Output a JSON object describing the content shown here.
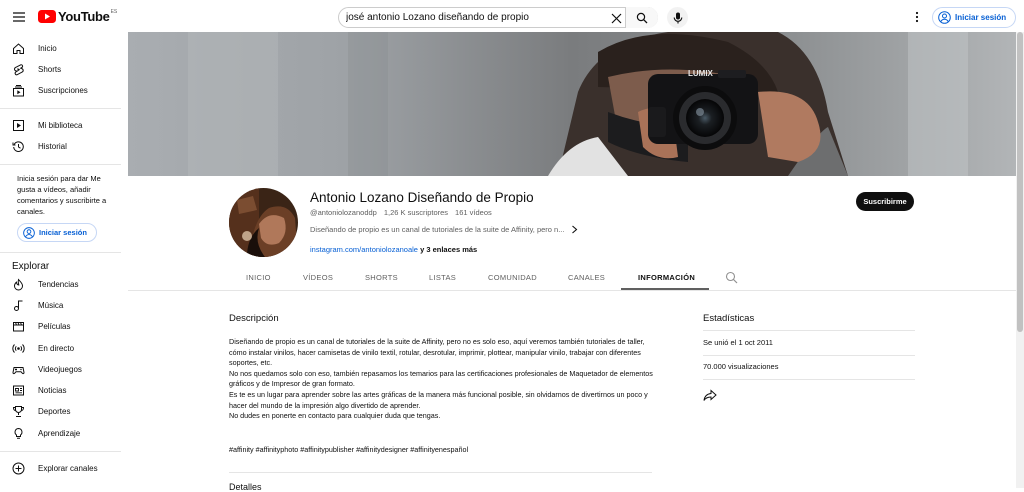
{
  "header": {
    "menu_icon": "hamburger-menu-icon",
    "logo_text": "YouTube",
    "country_code": "ES",
    "search_value": "josé antonio Lozano diseñando de propio",
    "signin_label": "Iniciar sesión"
  },
  "sidebar": {
    "items": [
      {
        "label": "Inicio",
        "icon": "home-icon"
      },
      {
        "label": "Shorts",
        "icon": "shorts-icon"
      },
      {
        "label": "Suscripciones",
        "icon": "subscriptions-icon"
      },
      {
        "label": "Mi biblioteca",
        "icon": "library-icon"
      },
      {
        "label": "Historial",
        "icon": "history-icon"
      }
    ],
    "signin_message": "Inicia sesión para dar Me gusta a vídeos, añadir comentarios y suscribirte a canales.",
    "signin_label": "Iniciar sesión",
    "explore_title": "Explorar",
    "explore_items": [
      {
        "label": "Tendencias",
        "icon": "trending-icon"
      },
      {
        "label": "Música",
        "icon": "music-icon"
      },
      {
        "label": "Películas",
        "icon": "movies-icon"
      },
      {
        "label": "En directo",
        "icon": "live-icon"
      },
      {
        "label": "Videojuegos",
        "icon": "gaming-icon"
      },
      {
        "label": "Noticias",
        "icon": "news-icon"
      },
      {
        "label": "Deportes",
        "icon": "sports-icon"
      },
      {
        "label": "Aprendizaje",
        "icon": "learning-icon"
      }
    ],
    "browse_label": "Explorar canales"
  },
  "channel": {
    "name": "Antonio Lozano Diseñando de Propio",
    "handle": "@antoniolozanoddp",
    "subscribers": "1,26 K suscriptores",
    "videos": "161 vídeos",
    "description_short": "Diseñando de propio es un canal de tutoriales de la suite de Affinity, pero n...",
    "link_url": "instagram.com/antoniolozanoale",
    "more_links": "y 3 enlaces más",
    "subscribe_label": "Suscribirme"
  },
  "tabs": [
    "INICIO",
    "VÍDEOS",
    "SHORTS",
    "LISTAS",
    "COMUNIDAD",
    "CANALES",
    "INFORMACIÓN"
  ],
  "active_tab": "INFORMACIÓN",
  "about": {
    "description_title": "Descripción",
    "description": "Diseñando de propio es un canal de tutoriales de la suite de Affinity, pero no es solo eso, aquí veremos también tutoriales de taller, cómo instalar vinilos, hacer camisetas de vinilo textil, rotular, desrotular, imprimir, plottear, manipular vinilo, trabajar con diferentes soportes, etc.\nNo nos quedamos solo con eso, también repasamos los temarios para las certificaciones profesionales de Maquetador de elementos gráficos y de Impresor de gran formato.\nEs te es un lugar para aprender sobre las artes gráficas de la manera más funcional posible, sin olvidarnos de divertirnos un poco y hacer del mundo de la impresión algo divertido de aprender.\nNo dudes en ponerte en contacto para cualquier duda que tengas.",
    "tags": "#affinity #affinityphoto #affinitypublisher #affinitydesigner #affinityenespañol",
    "next_section_partial": "Detalles",
    "stats_title": "Estadísticas",
    "joined": "Se unió el 1 oct 2011",
    "views": "70.000 visualizaciones",
    "share_icon": "share-icon"
  },
  "colors": {
    "accent_blue": "#065fd4",
    "youtube_red": "#ff0000",
    "subscribe_bg": "#0f0f0f",
    "secondary_text": "#606060"
  }
}
